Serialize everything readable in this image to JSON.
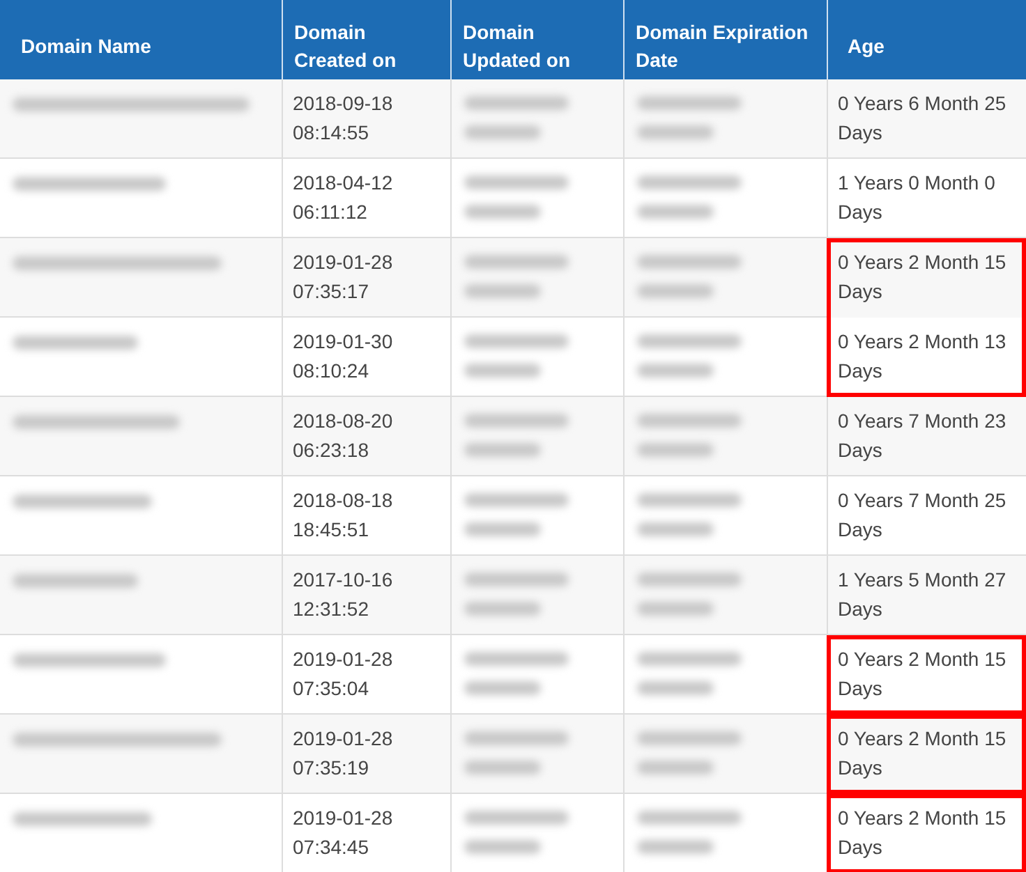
{
  "table": {
    "columns": [
      "Domain Name",
      "Domain Created on",
      "Domain Updated on",
      "Domain Expiration Date",
      "Age"
    ],
    "rows": [
      {
        "created": "2018-09-18 08:14:55",
        "age": "0 Years 6 Month 25 Days",
        "highlighted": false
      },
      {
        "created": "2018-04-12 06:11:12",
        "age": "1 Years 0 Month 0 Days",
        "highlighted": false
      },
      {
        "created": "2019-01-28 07:35:17",
        "age": "0 Years 2 Month 15 Days",
        "highlighted": true,
        "grouped_with_next": true
      },
      {
        "created": "2019-01-30 08:10:24",
        "age": "0 Years 2 Month 13 Days",
        "highlighted": true,
        "grouped_with_next": false
      },
      {
        "created": "2018-08-20 06:23:18",
        "age": "0 Years 7 Month 23 Days",
        "highlighted": false
      },
      {
        "created": "2018-08-18 18:45:51",
        "age": "0 Years 7 Month 25 Days",
        "highlighted": false
      },
      {
        "created": "2017-10-16 12:31:52",
        "age": "1 Years 5 Month 27 Days",
        "highlighted": false
      },
      {
        "created": "2019-01-28 07:35:04",
        "age": "0 Years 2 Month 15 Days",
        "highlighted": true,
        "grouped_with_next": false
      },
      {
        "created": "2019-01-28 07:35:19",
        "age": "0 Years 2 Month 15 Days",
        "highlighted": true,
        "grouped_with_next": false
      },
      {
        "created": "2019-01-28 07:34:45",
        "age": "0 Years 2 Month 15 Days",
        "highlighted": true,
        "grouped_with_next": false
      }
    ]
  }
}
